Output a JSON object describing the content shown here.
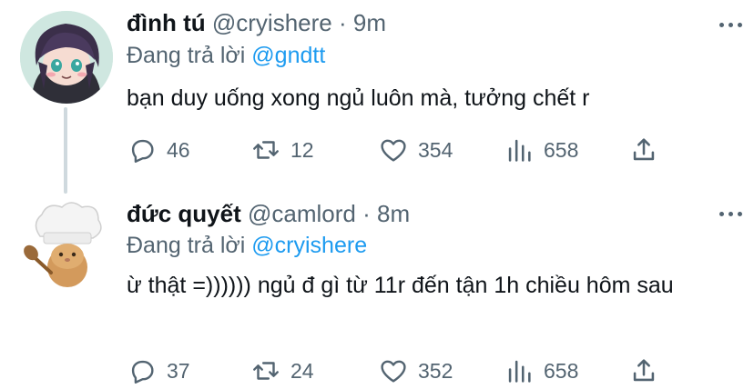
{
  "tweets": [
    {
      "name": "đình tú",
      "handle": "@cryishere",
      "time": "9m",
      "replying_label": "Đang trả lời",
      "replying_to": "@gndtt",
      "text": "bạn duy uống xong ngủ luôn mà, tưởng chết r",
      "replies": "46",
      "retweets": "12",
      "likes": "354",
      "views": "658"
    },
    {
      "name": "đức quyết",
      "handle": "@camlord",
      "time": "8m",
      "replying_label": "Đang trả lời",
      "replying_to": "@cryishere",
      "text": "ừ thật =)))))) ngủ đ gì từ 11r đến tận 1h chiều hôm sau",
      "replies": "37",
      "retweets": "24",
      "likes": "352",
      "views": "658"
    }
  ],
  "separator": "·",
  "colors": {
    "text": "#0f1419",
    "muted": "#536471",
    "accent": "#1d9bf0",
    "thread": "#cfd9de"
  },
  "icons": [
    "reply-icon",
    "retweet-icon",
    "like-icon",
    "views-icon",
    "share-icon",
    "more-icon"
  ]
}
